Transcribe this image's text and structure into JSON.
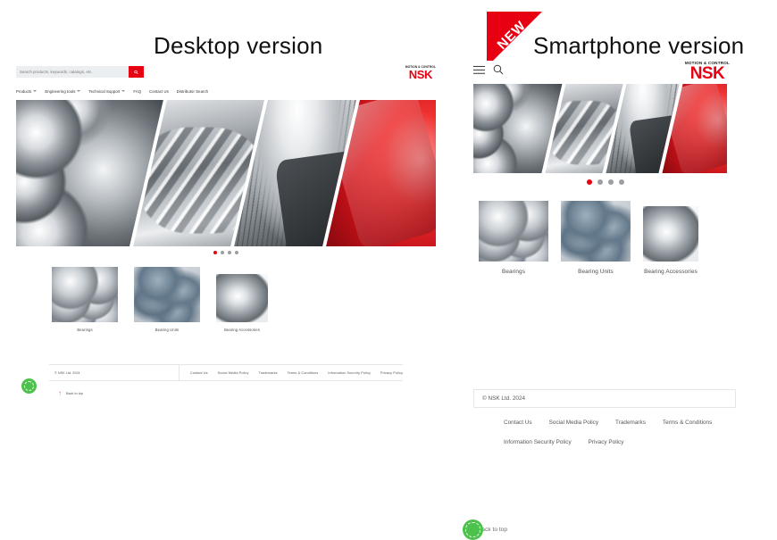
{
  "sections": {
    "desktop_title": "Desktop version",
    "phone_title": "Smartphone version",
    "new_badge": "NEW"
  },
  "brand": {
    "tagline": "MOTION & CONTROL",
    "name": "NSK",
    "red": "#e60012"
  },
  "desktop": {
    "search": {
      "placeholder": "Search products, keywords, catalogs, etc.",
      "value": "",
      "button_icon": "search-icon"
    },
    "nav": [
      {
        "label": "Products",
        "has_caret": true
      },
      {
        "label": "Engineering tools",
        "has_caret": true
      },
      {
        "label": "Technical Support",
        "has_caret": true
      },
      {
        "label": "FAQ",
        "has_caret": false
      },
      {
        "label": "Contact Us",
        "has_caret": false
      },
      {
        "label": "Distributor Search",
        "has_caret": false
      }
    ],
    "hero": {
      "panels": [
        "ball-bearing-closeup",
        "shaft-roller-bearing",
        "bearing-housing-unit",
        "red-automotive-component"
      ],
      "dots": 4,
      "active_dot": 1
    },
    "tiles": [
      {
        "label": "Bearings",
        "image": "bearings-group-photo"
      },
      {
        "label": "Bearing Units",
        "image": "bearing-units-photo"
      },
      {
        "label": "Bearing Accessories",
        "image": "adapter-sleeve-photo"
      }
    ],
    "footer": {
      "copyright": "© NSK Ltd. 2024",
      "links": [
        "Contact Us",
        "Social Media Policy",
        "Trademarks",
        "Terms & Conditions",
        "Information Security Policy",
        "Privacy Policy"
      ],
      "back_to_top": "Back to top",
      "cookie_icon": "cookie-consent-icon"
    }
  },
  "phone": {
    "header": {
      "menu_icon": "hamburger-menu-icon",
      "search_icon": "search-icon"
    },
    "hero": {
      "panels": [
        "ball-bearing-closeup",
        "shaft-roller-bearing",
        "bearing-housing-unit",
        "red-automotive-component"
      ],
      "dots": 4,
      "active_dot": 1
    },
    "tiles": [
      {
        "label": "Bearings",
        "image": "bearings-group-photo"
      },
      {
        "label": "Bearing Units",
        "image": "bearing-units-photo"
      },
      {
        "label": "Bearing Accessories",
        "image": "adapter-sleeve-photo"
      }
    ],
    "footer": {
      "copyright": "© NSK Ltd. 2024",
      "links_row1": [
        "Contact Us",
        "Social Media Policy",
        "Trademarks",
        "Terms & Conditions"
      ],
      "links_row2": [
        "Information Security Policy",
        "Privacy Policy"
      ],
      "back_to_top": "Back to top",
      "cookie_icon": "cookie-consent-icon"
    }
  }
}
